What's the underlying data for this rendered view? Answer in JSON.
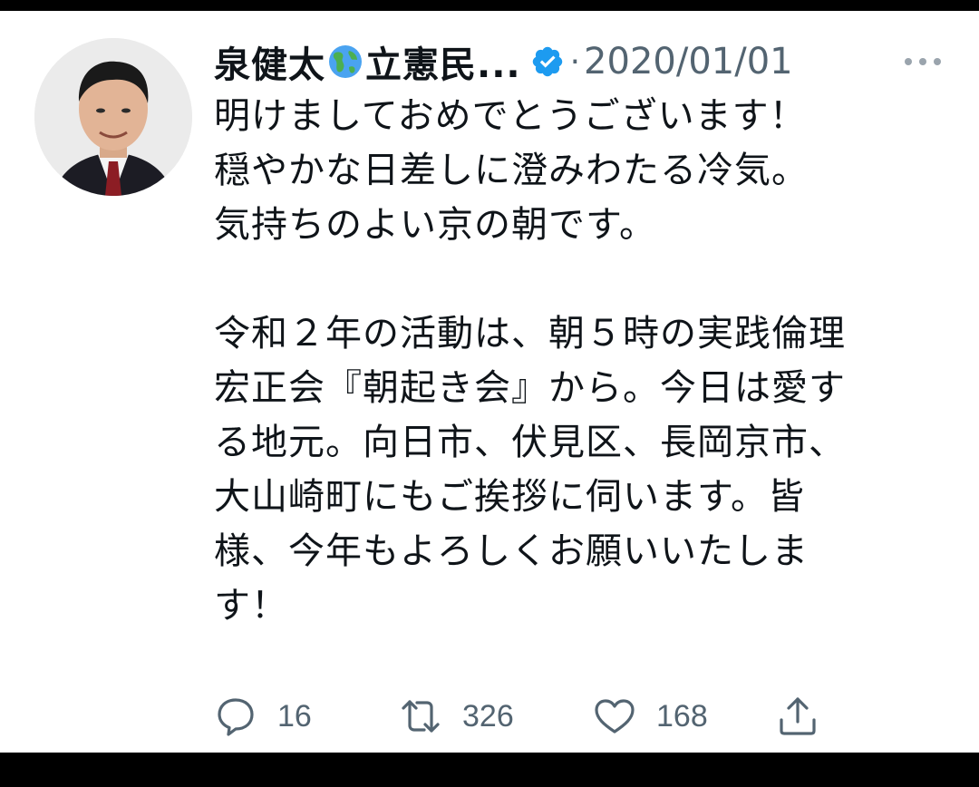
{
  "tweet": {
    "author_name": "泉健太",
    "author_name_suffix": "立憲民...",
    "separator": "·",
    "timestamp": "2020/01/01",
    "text": "明けましておめでとうございます！\n穏やかな日差しに澄みわたる冷気。\n気持ちのよい京の朝です。\n\n令和２年の活動は、朝５時の実践倫理\n宏正会『朝起き会』から。今日は愛す\nる地元。向日市、伏見区、長岡京市、\n大山崎町にもご挨拶に伺います。皆\n様、今年もよろしくお願いいたしま\nす！",
    "icons": {
      "name_emoji": "globe-americas-icon",
      "verified": "verified-badge-icon",
      "more": "more-dots-icon"
    },
    "actions": {
      "reply_count": "16",
      "retweet_count": "326",
      "like_count": "168",
      "share_icon": "share-icon"
    },
    "colors": {
      "verified": "#1d9bf0",
      "secondary_text": "#536471",
      "primary_text": "#0f1419",
      "background": "#ffffff"
    }
  }
}
